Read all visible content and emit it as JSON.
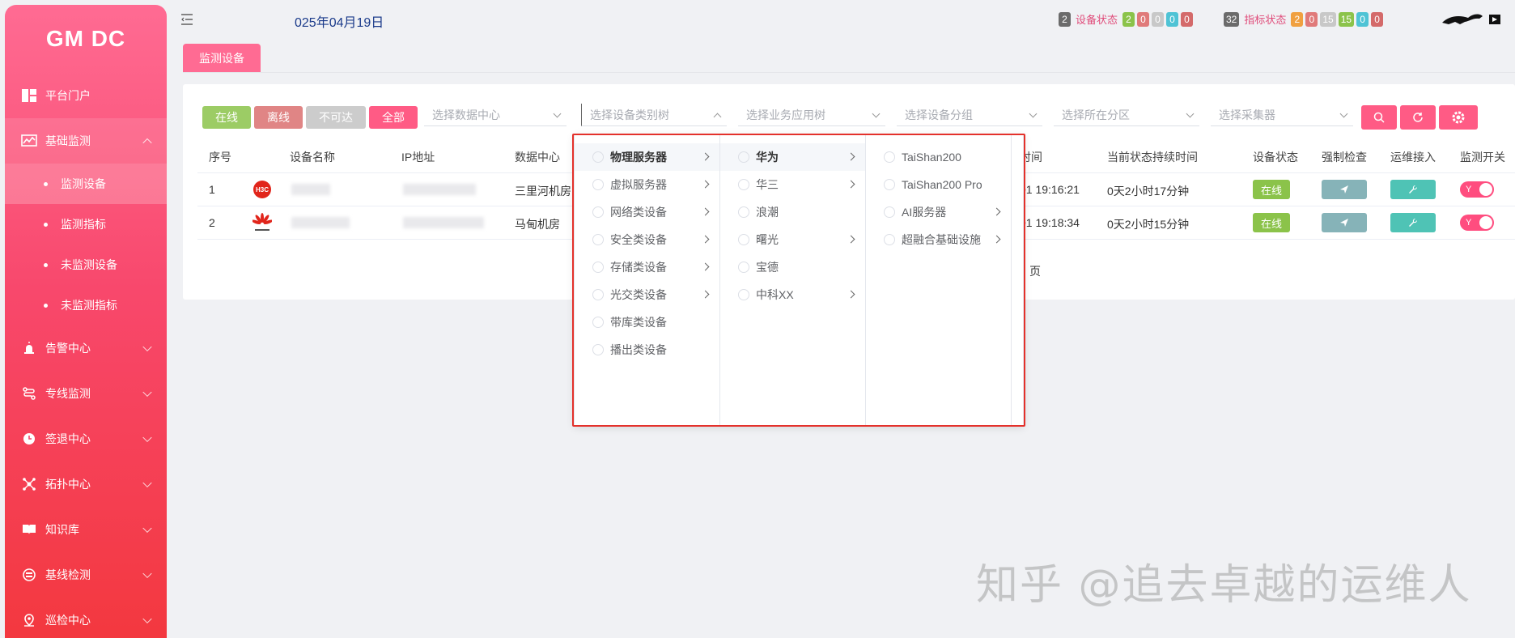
{
  "sidebar": {
    "logo": "GM DC",
    "items": [
      {
        "label": "平台门户"
      },
      {
        "label": "基础监测"
      },
      {
        "label": "告警中心"
      },
      {
        "label": "专线监测"
      },
      {
        "label": "签退中心"
      },
      {
        "label": "拓扑中心"
      },
      {
        "label": "知识库"
      },
      {
        "label": "基线检测"
      },
      {
        "label": "巡检中心"
      }
    ],
    "subitems": [
      {
        "label": "监测设备"
      },
      {
        "label": "监测指标"
      },
      {
        "label": "未监测设备"
      },
      {
        "label": "未监测指标"
      }
    ]
  },
  "header": {
    "date": "025年04月19日",
    "device_status": {
      "total": "2",
      "label": "设备状态",
      "counts": [
        "2",
        "0",
        "0",
        "0",
        "0"
      ]
    },
    "metric_status": {
      "total": "32",
      "label": "指标状态",
      "counts": [
        "2",
        "0",
        "15",
        "15",
        "0",
        "0"
      ]
    }
  },
  "tab": {
    "label": "监测设备"
  },
  "filters": {
    "online": "在线",
    "offline": "离线",
    "unreachable": "不可达",
    "all": "全部",
    "datacenter": "选择数据中心",
    "category": "选择设备类别树",
    "business": "选择业务应用树",
    "group": "选择设备分组",
    "zone": "选择所在分区",
    "collector": "选择采集器"
  },
  "table": {
    "headers": [
      "序号",
      "设备名称",
      "IP地址",
      "数据中心",
      "时间",
      "当前状态持续时间",
      "设备状态",
      "强制检查",
      "运维接入",
      "监测开关"
    ],
    "rows": [
      {
        "index": "1",
        "datacenter": "三里河机房",
        "time": "01 19:16:21",
        "duration": "0天2小时17分钟",
        "status": "在线",
        "switch": "Y"
      },
      {
        "index": "2",
        "datacenter": "马甸机房",
        "time": "01 19:18:34",
        "duration": "0天2小时15分钟",
        "status": "在线",
        "switch": "Y"
      }
    ],
    "pager_text": "页"
  },
  "cascader": {
    "col1": [
      "物理服务器",
      "虚拟服务器",
      "网络类设备",
      "安全类设备",
      "存储类设备",
      "光交类设备",
      "带库类设备",
      "播出类设备"
    ],
    "col2": [
      "华为",
      "华三",
      "浪潮",
      "曙光",
      "宝德",
      "中科XX"
    ],
    "col3": [
      "TaiShan200",
      "TaiShan200 Pro",
      "AI服务器",
      "超融合基础设施"
    ]
  },
  "watermark": "知乎 @追去卓越的运维人",
  "colors": {
    "accent": "#ff5b85",
    "online": "#8bc34a",
    "offline": "#e08080",
    "unreachable": "#c8c8c8",
    "teal": "#4fc3b5",
    "slate": "#86b3b8"
  }
}
